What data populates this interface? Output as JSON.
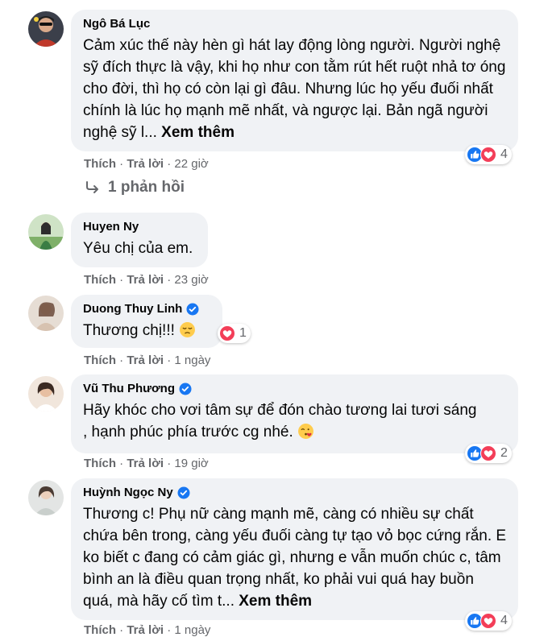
{
  "comments": [
    {
      "author": "Ngô Bá Lục",
      "verified": false,
      "text": "Cảm xúc thế này hèn gì hát lay động lòng người. Người nghệ sỹ đích thực là vậy, khi họ như con tằm rút hết ruột nhả tơ óng cho đời, thì họ có còn lại gì đâu. Nhưng lúc họ yếu đuối nhất chính là lúc họ mạnh mẽ nhất, và ngược lại. Bản ngã người nghệ sỹ l...",
      "see_more": "Xem thêm",
      "like": "Thích",
      "reply": "Trả lời",
      "time": "22 giờ",
      "reaction_count": "4",
      "reactions": [
        "like-icon",
        "love-icon"
      ]
    },
    {
      "author": "Huyen Ny",
      "verified": false,
      "text": "Yêu chị của em.",
      "like": "Thích",
      "reply": "Trả lời",
      "time": "23 giờ"
    },
    {
      "author": "Duong Thuy Linh",
      "verified": true,
      "text": "Thương chị!!!",
      "emoji": "pensive-face-emoji",
      "like": "Thích",
      "reply": "Trả lời",
      "time": "1 ngày",
      "reaction_count": "1",
      "reactions": [
        "love-icon"
      ]
    },
    {
      "author": "Vũ Thu Phương",
      "verified": true,
      "text_line1": "Hãy khóc cho vơi tâm sự để đón chào tương lai tươi sáng",
      "text_line2": ", hạnh phúc phía trước cg nhé.",
      "emoji": "face-blowing-kiss-emoji",
      "like": "Thích",
      "reply": "Trả lời",
      "time": "19 giờ",
      "reaction_count": "2",
      "reactions": [
        "like-icon",
        "love-icon"
      ]
    },
    {
      "author": "Huỳnh Ngọc Ny",
      "verified": true,
      "text": "Thương c! Phụ nữ càng mạnh mẽ, càng có nhiều sự chất chứa bên trong, càng yếu đuối càng tự tạo vỏ bọc cứng rắn. E ko biết c đang có cảm giác gì, nhưng e vẫn muốn chúc c, tâm bình an là điều quan trọng nhất, ko phải vui quá hay buồn quá, mà hãy cố tìm t...",
      "see_more": "Xem thêm",
      "like": "Thích",
      "reply": "Trả lời",
      "time": "1 ngày",
      "reaction_count": "4",
      "reactions": [
        "like-icon",
        "love-icon"
      ]
    }
  ],
  "replies_link": "1 phản hồi",
  "colors": {
    "bubble": "#f0f2f5",
    "meta": "#65676b",
    "like_blue": "#1877f2",
    "love_red": "#f33e58",
    "verified": "#1877f2"
  }
}
